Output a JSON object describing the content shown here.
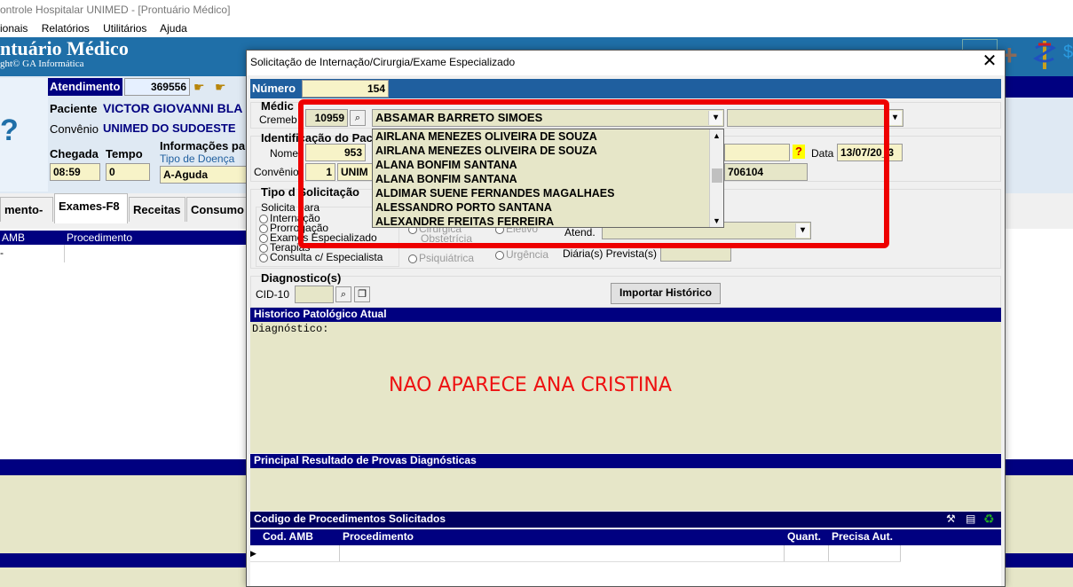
{
  "window": {
    "title": "ontrole Hospitalar UNIMED - [Prontuário Médico]"
  },
  "menu": [
    "ionais",
    "Relatórios",
    "Utilitários",
    "Ajuda"
  ],
  "background": {
    "app_title": "ntuário Médico",
    "app_subtitle": "ght© GA Informática",
    "atendimento_label": "Atendimento",
    "atendimento_value": "369556",
    "paciente_label": "Paciente",
    "paciente_value": "VICTOR GIOVANNI BLA",
    "convenio_label": "Convênio",
    "convenio_value": "UNIMED DO SUDOESTE",
    "chegada_label": "Chegada",
    "chegada_value": "08:59",
    "tempo_label": "Tempo",
    "tempo_value": "0",
    "info_label": "Informações pa",
    "tipo_doenca_label": "Tipo de Doença",
    "tipo_doenca_value": "A-Aguda",
    "tabs": [
      "mento-F8",
      "Exames-F8",
      "Receitas",
      "Consumo"
    ],
    "grid_headers": [
      "AMB",
      "Procedimento"
    ],
    "grid_first_cell": "-",
    "photo_symbol": "?"
  },
  "dialog": {
    "title": "Solicitação de Internação/Cirurgia/Exame Especializado",
    "numero_label": "Número",
    "numero_value": "154",
    "medico_label": "Médic",
    "cremeb_label": "Cremeb",
    "cremeb_value": "10959",
    "medico_selected": "ABSAMAR BARRETO SIMOES",
    "medico_options": [
      "AIRLANA MENEZES OLIVEIRA DE SOUZA",
      "AIRLANA MENEZES OLIVEIRA DE SOUZA",
      "ALANA BONFIM SANTANA",
      "ALANA BONFIM SANTANA",
      "ALDIMAR SUENE FERNANDES MAGALHAES",
      "ALESSANDRO PORTO SANTANA",
      "ALEXANDRE FREITAS FERREIRA"
    ],
    "identificacao_label": "Identificação do Pac",
    "nome_label": "Nome",
    "nome_code": "953",
    "data_label": "Data",
    "data_value": "13/07/20_3",
    "convenio_label": "Convênio",
    "convenio_code": "1",
    "convenio_name": "UNIM",
    "carteira_value": "706104",
    "tipo_solicitacao_label": "Tipo d  Solicitação",
    "solicita_para_label": "Solicita  para",
    "solicita_options": [
      "Internação",
      "Prorrogação",
      "Exames Especializado",
      "Terapias",
      "Consulta c/ Especialista"
    ],
    "carater_options": [
      "Cirúrgica",
      "Obstetrícia",
      "Psiquiátrica"
    ],
    "urgencia_options": [
      "Eletivo",
      "Urgência"
    ],
    "atend_label": "Atend.",
    "diarias_label": "Diária(s) Prevista(s)",
    "diagnostico_label": "Diagnostico(s)",
    "cid_label": "CID-10",
    "importar_label": "Importar Histórico",
    "historico_label": "Historico Patológico Atual",
    "historico_text": "Diagnóstico:",
    "resultado_label": "Principal Resultado de Provas Diagnósticas",
    "procedimentos_label": "Codigo de Procedimentos Solicitados",
    "proc_headers": [
      "Cod. AMB",
      "Procedimento",
      "Quant.",
      "Precisa Aut."
    ],
    "help_icon": "?"
  },
  "annotation": {
    "text": "NAO APARECE ANA CRISTINA",
    "color": "#ee1111"
  },
  "colors": {
    "navy": "#000080",
    "cream": "#e6e6c8",
    "yellow_field": "#f7f3c8",
    "header_blue": "#1f6fa8",
    "highlight_red": "#ee0000"
  }
}
